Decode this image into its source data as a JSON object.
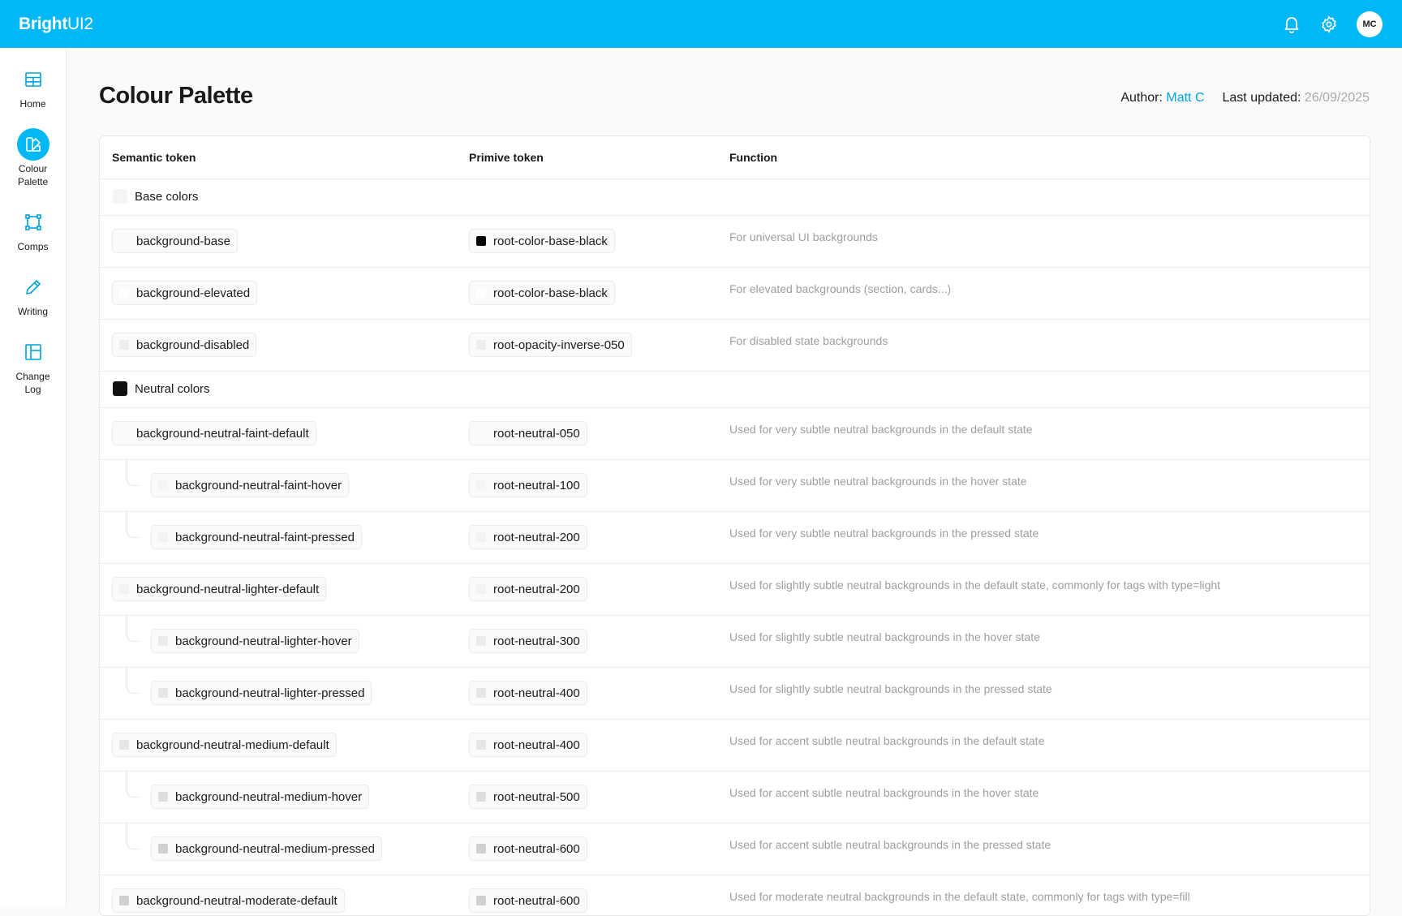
{
  "app": {
    "brand_bold": "Bright",
    "brand_light": "UI2",
    "avatar_initials": "MC"
  },
  "header": {
    "notifications_icon": "bell-icon",
    "settings_icon": "gear-icon"
  },
  "sidebar": {
    "items": [
      {
        "label": "Home",
        "icon": "table-icon",
        "active": false
      },
      {
        "label": "Colour Palette",
        "icon": "palette-icon",
        "active": true
      },
      {
        "label": "Comps",
        "icon": "vector-square-icon",
        "active": false
      },
      {
        "label": "Writing",
        "icon": "pencil-icon",
        "active": false
      },
      {
        "label": "Change Log",
        "icon": "layout-icon",
        "active": false
      }
    ]
  },
  "page": {
    "title": "Colour Palette",
    "author_label": "Author:",
    "author_name": "Matt C",
    "updated_label": "Last updated:",
    "updated_date": "26/09/2025"
  },
  "table": {
    "columns": [
      "Semantic token",
      "Primive token",
      "Function"
    ],
    "groups": [
      {
        "label": "Base colors",
        "swatch": "#f5f5f5",
        "rows": [
          {
            "semantic": "background-base",
            "semantic_swatch": "#fafafa",
            "primitive": "root-color-base-black",
            "primitive_swatch": "#000000",
            "function": "For universal UI backgrounds",
            "child": false
          },
          {
            "semantic": "background-elevated",
            "semantic_swatch": "#ffffff",
            "primitive": "root-color-base-black",
            "primitive_swatch": "#ffffff",
            "function": "For elevated backgrounds (section, cards...)",
            "child": false
          },
          {
            "semantic": "background-disabled",
            "semantic_swatch": "#ededed",
            "primitive": "root-opacity-inverse-050",
            "primitive_swatch": "#ededed",
            "function": "For disabled state backgrounds",
            "child": false
          }
        ]
      },
      {
        "label": "Neutral colors",
        "swatch": "#111111",
        "rows": [
          {
            "semantic": "background-neutral-faint-default",
            "semantic_swatch": "#fafafa",
            "primitive": "root-neutral-050",
            "primitive_swatch": "#fafafa",
            "function": "Used for very subtle neutral backgrounds in the default state",
            "child": false
          },
          {
            "semantic": "background-neutral-faint-hover",
            "semantic_swatch": "#f5f5f5",
            "primitive": "root-neutral-100",
            "primitive_swatch": "#f5f5f5",
            "function": "Used for very subtle neutral backgrounds in the hover state",
            "child": true
          },
          {
            "semantic": "background-neutral-faint-pressed",
            "semantic_swatch": "#f2f2f2",
            "primitive": "root-neutral-200",
            "primitive_swatch": "#f2f2f2",
            "function": "Used for very subtle neutral backgrounds in the pressed state",
            "child": true
          },
          {
            "semantic": "background-neutral-lighter-default",
            "semantic_swatch": "#f2f2f2",
            "primitive": "root-neutral-200",
            "primitive_swatch": "#f2f2f2",
            "function": "Used for slightly subtle neutral backgrounds in the default state, commonly for tags with type=light",
            "child": false
          },
          {
            "semantic": "background-neutral-lighter-hover",
            "semantic_swatch": "#ebebeb",
            "primitive": "root-neutral-300",
            "primitive_swatch": "#ebebeb",
            "function": "Used for slightly subtle neutral backgrounds in the hover state",
            "child": true
          },
          {
            "semantic": "background-neutral-lighter-pressed",
            "semantic_swatch": "#e6e6e6",
            "primitive": "root-neutral-400",
            "primitive_swatch": "#e6e6e6",
            "function": "Used for slightly subtle neutral backgrounds in the pressed state",
            "child": true
          },
          {
            "semantic": "background-neutral-medium-default",
            "semantic_swatch": "#e6e6e6",
            "primitive": "root-neutral-400",
            "primitive_swatch": "#e6e6e6",
            "function": "Used for accent subtle neutral backgrounds in the default state",
            "child": false
          },
          {
            "semantic": "background-neutral-medium-hover",
            "semantic_swatch": "#dedede",
            "primitive": "root-neutral-500",
            "primitive_swatch": "#dedede",
            "function": "Used for accent subtle neutral backgrounds in the hover state",
            "child": true
          },
          {
            "semantic": "background-neutral-medium-pressed",
            "semantic_swatch": "#d0d0d0",
            "primitive": "root-neutral-600",
            "primitive_swatch": "#d0d0d0",
            "function": "Used for accent subtle neutral backgrounds in the pressed state",
            "child": true
          },
          {
            "semantic": "background-neutral-moderate-default",
            "semantic_swatch": "#d0d0d0",
            "primitive": "root-neutral-600",
            "primitive_swatch": "#d0d0d0",
            "function": "Used for moderate neutral backgrounds in the default state, commonly for tags with type=fill",
            "child": false
          }
        ]
      }
    ]
  }
}
